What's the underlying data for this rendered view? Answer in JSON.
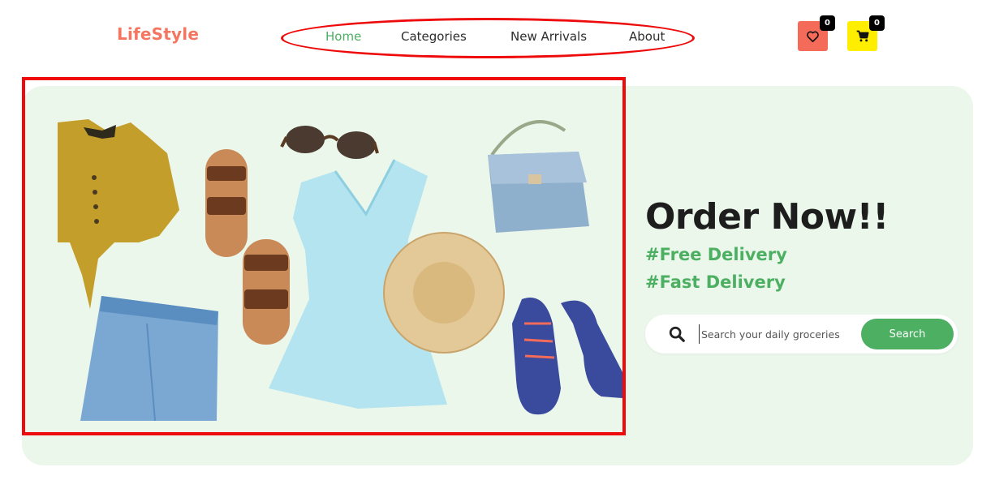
{
  "header": {
    "logo": "LifeStyle",
    "nav": [
      {
        "label": "Home",
        "active": true
      },
      {
        "label": "Categories",
        "active": false
      },
      {
        "label": "New Arrivals",
        "active": false
      },
      {
        "label": "About",
        "active": false
      }
    ],
    "wishlist": {
      "icon": "heart-icon",
      "count": "0",
      "color": "#f46b5a"
    },
    "cart": {
      "icon": "cart-icon",
      "count": "0",
      "color": "#ffee00"
    }
  },
  "hero": {
    "title": "Order Now!!",
    "tags": [
      "#Free Delivery",
      "#Fast Delivery"
    ],
    "search": {
      "placeholder": "Search your daily groceries",
      "button": "Search"
    },
    "image_items": [
      "blouse",
      "jeans",
      "sandal",
      "sandal",
      "sunglasses",
      "dress",
      "straw-hat",
      "handbag",
      "sneakers"
    ]
  },
  "colors": {
    "accent": "#4caf62",
    "logo": "#f47560",
    "hero_bg": "#ecf7ec",
    "highlight": "#ee0a0a"
  }
}
